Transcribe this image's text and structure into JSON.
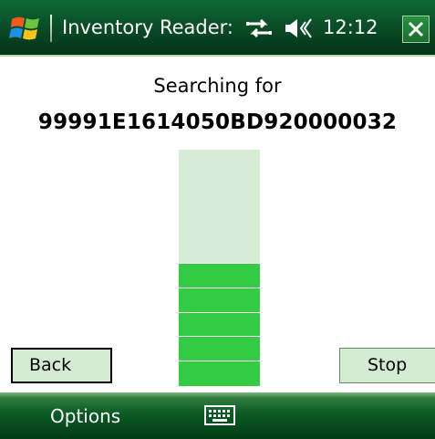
{
  "titlebar": {
    "title": "Inventory Reader:",
    "clock": "12:12",
    "icons": [
      "windows-start-icon",
      "connectivity-icon",
      "speaker-icon",
      "close-icon"
    ]
  },
  "search": {
    "label": "Searching for",
    "tag_id": "99991E1614050BD920000032"
  },
  "signal_meter": {
    "level_fraction": 0.52,
    "segments_lit": 5,
    "empty_color": "#d7ebd7",
    "fill_color": "#33cc44"
  },
  "buttons": {
    "back": "Back",
    "stop": "Stop"
  },
  "menubar": {
    "left_soft_key": "Options",
    "center_icon": "keyboard-icon"
  },
  "colors": {
    "titlebar": "#0a4f28",
    "menubar": "#0b5a24",
    "button_bg": "#d4ebd3"
  }
}
